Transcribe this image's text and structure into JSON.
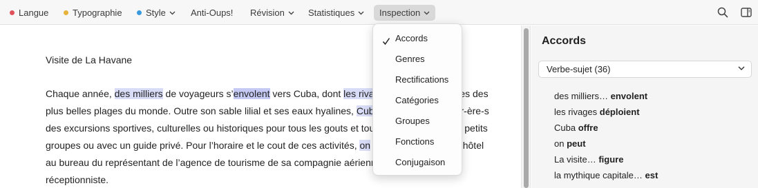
{
  "toolbar": {
    "items": [
      {
        "label": "Langue",
        "dot": "#e0525a"
      },
      {
        "label": "Typographie",
        "dot": "#e8b33a"
      },
      {
        "label": "Style",
        "dot": "#3a9ae0"
      },
      {
        "label": "Anti-Oups!"
      },
      {
        "label": "Révision"
      },
      {
        "label": "Statistiques"
      },
      {
        "label": "Inspection"
      }
    ],
    "right_icons": [
      "search-icon",
      "sidebar-toggle-icon"
    ]
  },
  "document": {
    "title": "Visite de La Havane",
    "lines": [
      [
        "Chaque année, ",
        "des milliers",
        " de voyageurs s’",
        "envolent",
        " vers Cuba, dont ",
        "les riva",
        "",
        "ues des"
      ],
      [
        "plus belles plages du monde. Outre son sable lilial et ses eaux hyalines, ",
        "Cub",
        "",
        "r-ère-s"
      ],
      [
        "des excursions sportives, culturelles ou historiques pour tous les gouts et tou",
        "",
        "petits"
      ],
      [
        "groupes ou avec un guide privé. Pour l’horaire et le cout de ces activités, ",
        "on",
        "",
        "n hôtel"
      ],
      [
        "au bureau du représentant de l’agence de tourisme de sa compagnie aérienn",
        ""
      ],
      [
        "réceptionniste."
      ]
    ]
  },
  "menu": {
    "items": [
      "Accords",
      "Genres",
      "Rectifications",
      "Catégories",
      "Groupes",
      "Fonctions",
      "Conjugaison"
    ],
    "checked": "Accords"
  },
  "panel": {
    "title": "Accords",
    "select_value": "Verbe-sujet (36)",
    "entries": [
      {
        "subject": "des milliers…",
        "verb": "envolent"
      },
      {
        "subject": "les rivages",
        "verb": "déploient"
      },
      {
        "subject": "Cuba",
        "verb": "offre"
      },
      {
        "subject": "on",
        "verb": "peut"
      },
      {
        "subject": "La visite…",
        "verb": "figure"
      },
      {
        "subject": "la mythique capitale…",
        "verb": "est"
      }
    ]
  }
}
